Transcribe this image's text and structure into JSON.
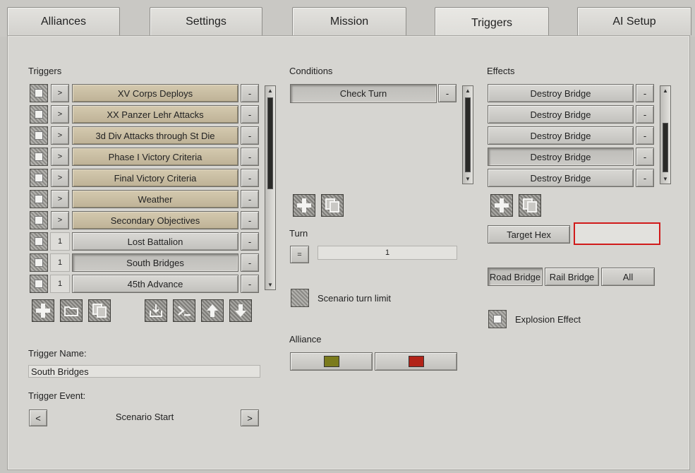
{
  "tabs": [
    "Alliances",
    "Settings",
    "Mission",
    "Triggers",
    "AI Setup"
  ],
  "triggers": {
    "heading": "Triggers",
    "items": [
      {
        "label": "XV  Corps Deploys",
        "toggle": ">",
        "style": "tan"
      },
      {
        "label": "XX Panzer Lehr Attacks",
        "toggle": ">",
        "style": "tan"
      },
      {
        "label": "3d Div Attacks through St Die",
        "toggle": ">",
        "style": "tan"
      },
      {
        "label": "Phase I Victory Criteria",
        "toggle": ">",
        "style": "tan"
      },
      {
        "label": "Final Victory Criteria",
        "toggle": ">",
        "style": "tan"
      },
      {
        "label": "Weather",
        "toggle": ">",
        "style": "tan"
      },
      {
        "label": "Secondary Objectives",
        "toggle": ">",
        "style": "tan"
      },
      {
        "label": "Lost Battalion",
        "toggle": "1",
        "style": "gray"
      },
      {
        "label": "South Bridges",
        "toggle": "1",
        "style": "selected"
      },
      {
        "label": "45th Advance",
        "toggle": "1",
        "style": "gray"
      }
    ],
    "remove_label": "-",
    "toolbar_icons": [
      "plus-icon",
      "folder-icon",
      "copy-icon",
      "import-icon",
      "console-icon",
      "arrow-up-icon",
      "arrow-down-icon"
    ]
  },
  "trigger_name": {
    "label": "Trigger Name:",
    "value": "South Bridges"
  },
  "trigger_event": {
    "label": "Trigger Event:",
    "value": "Scenario Start",
    "prev": "<",
    "next": ">"
  },
  "conditions": {
    "heading": "Conditions",
    "items": [
      {
        "label": "Check Turn",
        "selected": true
      }
    ],
    "remove_label": "-"
  },
  "turn": {
    "label": "Turn",
    "operator": "=",
    "value": "1"
  },
  "scenario_turn_limit": {
    "label": "Scenario turn limit"
  },
  "alliance": {
    "label": "Alliance",
    "buttons": [
      {
        "color": "#7b7b1c"
      },
      {
        "color": "#b22318"
      }
    ]
  },
  "effects": {
    "heading": "Effects",
    "items": [
      {
        "label": "Destroy Bridge",
        "selected": false
      },
      {
        "label": "Destroy Bridge",
        "selected": false
      },
      {
        "label": "Destroy Bridge",
        "selected": false
      },
      {
        "label": "Destroy Bridge",
        "selected": true
      },
      {
        "label": "Destroy Bridge",
        "selected": false
      }
    ],
    "remove_label": "-",
    "target_hex_label": "Target Hex",
    "target_hex_value": "",
    "bridge_types": [
      {
        "label": "Road Bridge",
        "active": true
      },
      {
        "label": "Rail Bridge",
        "active": false
      },
      {
        "label": "All",
        "active": false
      }
    ],
    "explosion_effect_label": "Explosion Effect"
  },
  "colors": {
    "highlight": "#d11a1a",
    "tan": "#c9bea3"
  }
}
